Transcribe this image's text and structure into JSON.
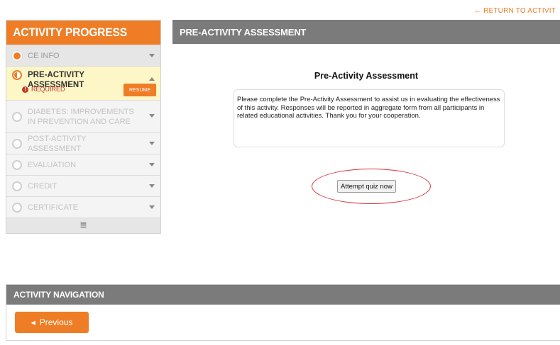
{
  "return_link": {
    "label": "RETURN TO ACTIVIT",
    "icon": "arrow-left-icon"
  },
  "sidebar": {
    "title": "ACTIVITY PROGRESS",
    "steps": [
      {
        "label": "CE INFO",
        "state": "done"
      },
      {
        "label": "PRE-ACTIVITY ASSESSMENT",
        "state": "active",
        "status": "REQUIRED",
        "action": "RESUME"
      },
      {
        "label": "DIABETES: IMPROVEMENTS IN PREVENTION AND CARE",
        "state": "locked"
      },
      {
        "label": "POST-ACTIVITY ASSESSMENT",
        "state": "locked"
      },
      {
        "label": "EVALUATION",
        "state": "locked"
      },
      {
        "label": "CREDIT",
        "state": "locked"
      },
      {
        "label": "CERTIFICATE",
        "state": "locked"
      }
    ],
    "menu_icon": "≡"
  },
  "main": {
    "header": "PRE-ACTIVITY ASSESSMENT",
    "title": "Pre-Activity Assessment",
    "instructions": "Please complete the Pre-Activity Assessment to assist us in evaluating the effectiveness of this activity. Responses will be reported in aggregate form from all participants in related educational activities. Thank you for your cooperation.",
    "attempt_button": "Attempt quiz now"
  },
  "navigation": {
    "header": "ACTIVITY NAVIGATION",
    "previous_button": "Previous"
  },
  "colors": {
    "accent": "#ee7d26",
    "header_gray": "#7b7b7b",
    "active_step_bg": "#fdf6c6",
    "required_red": "#c0392b",
    "highlight_ring": "#d9363e"
  }
}
